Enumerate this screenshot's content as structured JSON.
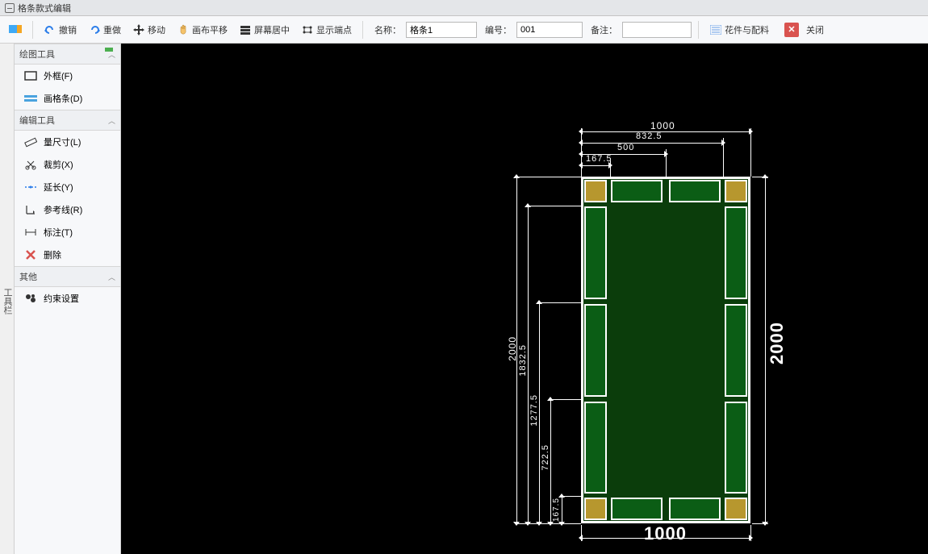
{
  "window": {
    "title": "格条款式编辑"
  },
  "toolbar": {
    "undo": "撤销",
    "redo": "重做",
    "move": "移动",
    "pan": "画布平移",
    "center": "屏幕居中",
    "showpoints": "显示端点",
    "name_lbl": "名称：",
    "name_val": "格条1",
    "code_lbl": "编号：",
    "code_val": "001",
    "remark_lbl": "备注：",
    "remark_val": "",
    "parts": "花件与配料",
    "close": "关闭"
  },
  "tabstrip": {
    "label": "工具栏"
  },
  "sidebar": {
    "g1": "绘图工具",
    "g1_items": [
      {
        "label": "外框(F)"
      },
      {
        "label": "画格条(D)"
      }
    ],
    "g2": "编辑工具",
    "g2_items": [
      {
        "label": "量尺寸(L)"
      },
      {
        "label": "裁剪(X)"
      },
      {
        "label": "延长(Y)"
      },
      {
        "label": "参考线(R)"
      },
      {
        "label": "标注(T)"
      },
      {
        "label": "删除"
      }
    ],
    "g3": "其他",
    "g3_items": [
      {
        "label": "约束设置"
      }
    ]
  },
  "dims": {
    "top_1000": "1000",
    "top_832": "832.5",
    "top_500": "500",
    "top_167": "167.5",
    "right_2000": "2000",
    "bottom_1000": "1000",
    "left_2000": "2000",
    "left_1832": "1832.5",
    "left_1277": "1277.5",
    "left_722": "722.5",
    "left_167": "167.5"
  }
}
